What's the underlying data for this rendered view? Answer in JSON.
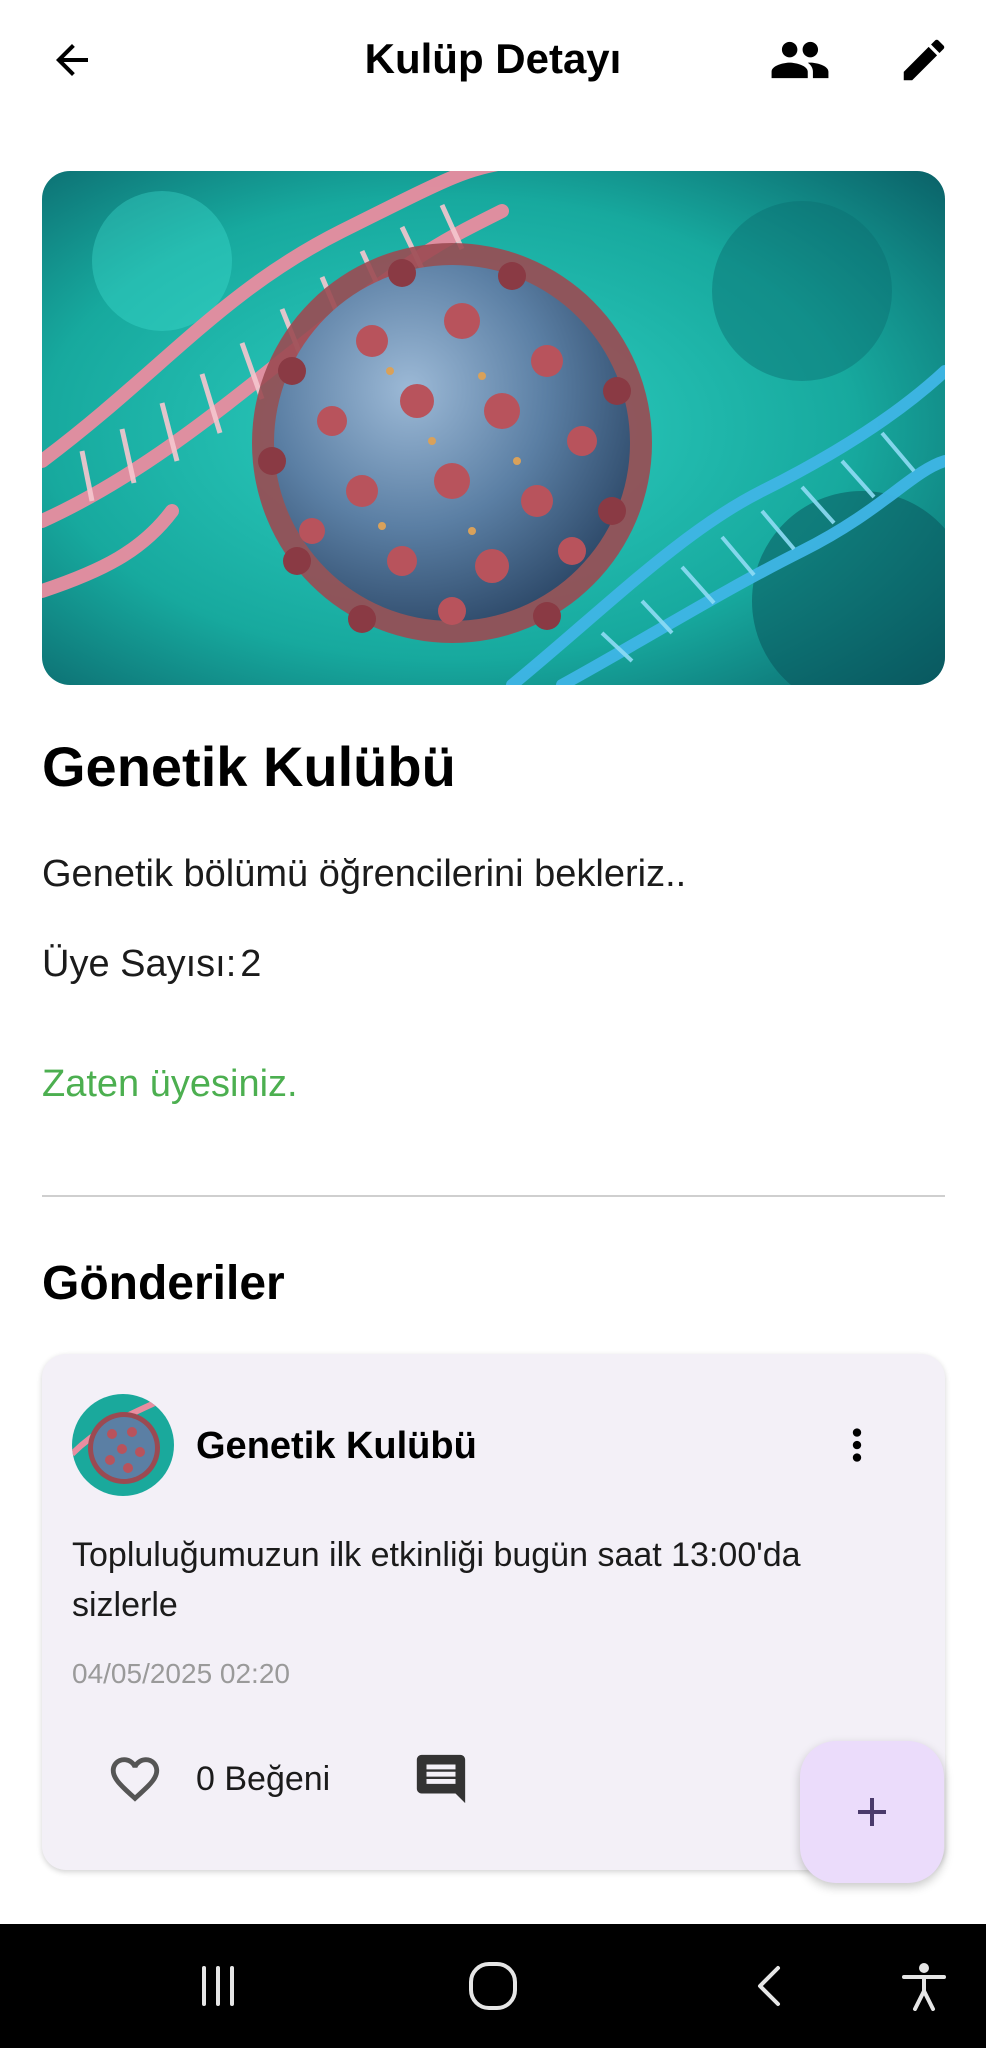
{
  "app_bar": {
    "title": "Kulüp Detayı",
    "back_icon": "arrow-back-icon",
    "members_icon": "group-icon",
    "edit_icon": "edit-pencil-icon"
  },
  "club": {
    "image_desc": "virus-dna-illustration",
    "name": "Genetik Kulübü",
    "description": "Genetik bölümü öğrencilerini bekleriz..",
    "member_count_label": "Üye Sayısı:",
    "member_count": "2",
    "membership_status": "Zaten üyesiniz."
  },
  "posts_section": {
    "title": "Gönderiler",
    "posts": [
      {
        "author": "Genetik Kulübü",
        "body": "Topluluğumuzun ilk etkinliği bugün saat 13:00'da sizlerle",
        "date": "04/05/2025 02:20",
        "likes_label": "0 Beğeni"
      }
    ]
  },
  "fab": {
    "icon": "plus-icon"
  },
  "system_nav": {
    "recents_icon": "recents-icon",
    "home_icon": "home-icon",
    "back_icon": "nav-back-icon",
    "accessibility_icon": "accessibility-icon"
  },
  "colors": {
    "status_green": "#4caf50",
    "card_bg": "#f3f0f7",
    "fab_bg": "#ebdcfb",
    "fab_icon": "#4a3a6b"
  }
}
